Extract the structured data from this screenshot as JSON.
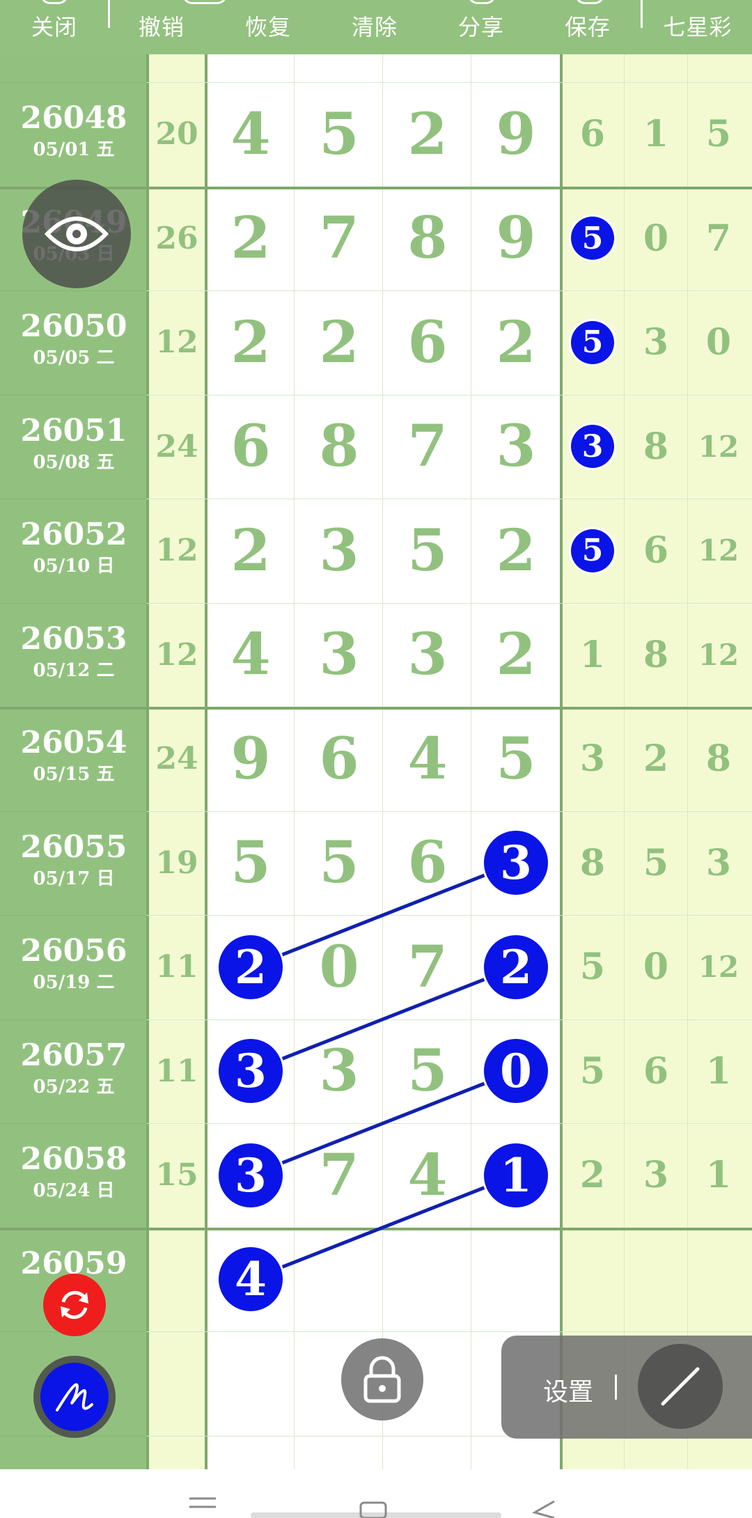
{
  "toolbar": {
    "items": [
      {
        "label": "关闭"
      },
      {
        "label": "撤销"
      },
      {
        "label": "恢复"
      },
      {
        "label": "清除"
      },
      {
        "label": "分享"
      },
      {
        "label": "保存"
      },
      {
        "label": "七星彩"
      }
    ]
  },
  "rows": [
    {
      "issue": "26048",
      "date": "05/01 五",
      "sum": "20",
      "digits": [
        "4",
        "5",
        "2",
        "9"
      ],
      "tail": [
        "6",
        "1",
        "5"
      ]
    },
    {
      "issue": "26049",
      "date": "05/03 日",
      "sum": "26",
      "digits": [
        "2",
        "7",
        "8",
        "9"
      ],
      "tail": [
        "5",
        "0",
        "7"
      ]
    },
    {
      "issue": "26050",
      "date": "05/05 二",
      "sum": "12",
      "digits": [
        "2",
        "2",
        "6",
        "2"
      ],
      "tail": [
        "5",
        "3",
        "0"
      ]
    },
    {
      "issue": "26051",
      "date": "05/08 五",
      "sum": "24",
      "digits": [
        "6",
        "8",
        "7",
        "3"
      ],
      "tail": [
        "3",
        "8",
        "12"
      ]
    },
    {
      "issue": "26052",
      "date": "05/10 日",
      "sum": "12",
      "digits": [
        "2",
        "3",
        "5",
        "2"
      ],
      "tail": [
        "5",
        "6",
        "12"
      ]
    },
    {
      "issue": "26053",
      "date": "05/12 二",
      "sum": "12",
      "digits": [
        "4",
        "3",
        "3",
        "2"
      ],
      "tail": [
        "1",
        "8",
        "12"
      ]
    },
    {
      "issue": "26054",
      "date": "05/15 五",
      "sum": "24",
      "digits": [
        "9",
        "6",
        "4",
        "5"
      ],
      "tail": [
        "3",
        "2",
        "8"
      ]
    },
    {
      "issue": "26055",
      "date": "05/17 日",
      "sum": "19",
      "digits": [
        "5",
        "5",
        "6",
        "3"
      ],
      "tail": [
        "8",
        "5",
        "3"
      ]
    },
    {
      "issue": "26056",
      "date": "05/19 二",
      "sum": "11",
      "digits": [
        "2",
        "0",
        "7",
        "2"
      ],
      "tail": [
        "5",
        "0",
        "12"
      ]
    },
    {
      "issue": "26057",
      "date": "05/22 五",
      "sum": "11",
      "digits": [
        "3",
        "3",
        "5",
        "0"
      ],
      "tail": [
        "5",
        "6",
        "1"
      ]
    },
    {
      "issue": "26058",
      "date": "05/24 日",
      "sum": "15",
      "digits": [
        "3",
        "7",
        "4",
        "1"
      ],
      "tail": [
        "2",
        "3",
        "1"
      ]
    },
    {
      "issue": "26059",
      "date": "",
      "sum": "",
      "digits": [
        "4",
        "",
        "",
        ""
      ],
      "tail": [
        "",
        "",
        ""
      ]
    },
    {
      "issue": "",
      "date": "",
      "sum": "",
      "digits": [
        "",
        "",
        "",
        ""
      ],
      "tail": [
        "",
        "",
        ""
      ]
    },
    {
      "issue": "",
      "date": "",
      "sum": "",
      "digits": [
        "",
        "",
        "",
        ""
      ],
      "tail": [
        "",
        "",
        ""
      ]
    }
  ],
  "marked_cells": [
    {
      "row": 1,
      "col": "tail",
      "index": 0
    },
    {
      "row": 2,
      "col": "tail",
      "index": 0
    },
    {
      "row": 3,
      "col": "tail",
      "index": 0
    },
    {
      "row": 4,
      "col": "tail",
      "index": 0
    },
    {
      "row": 7,
      "col": "digits",
      "index": 3
    },
    {
      "row": 8,
      "col": "digits",
      "index": 0
    },
    {
      "row": 8,
      "col": "digits",
      "index": 3
    },
    {
      "row": 9,
      "col": "digits",
      "index": 0
    },
    {
      "row": 9,
      "col": "digits",
      "index": 3
    },
    {
      "row": 10,
      "col": "digits",
      "index": 0
    },
    {
      "row": 10,
      "col": "digits",
      "index": 3
    },
    {
      "row": 11,
      "col": "digits",
      "index": 0
    }
  ],
  "drawn_lines": [
    {
      "from": {
        "row": 7,
        "index": 3
      },
      "to": {
        "row": 8,
        "index": 0
      }
    },
    {
      "from": {
        "row": 8,
        "index": 3
      },
      "to": {
        "row": 9,
        "index": 0
      }
    },
    {
      "from": {
        "row": 9,
        "index": 3
      },
      "to": {
        "row": 10,
        "index": 0
      }
    },
    {
      "from": {
        "row": 10,
        "index": 3
      },
      "to": {
        "row": 11,
        "index": 0
      }
    }
  ],
  "settings": {
    "label": "设置"
  },
  "colors": {
    "toolbar_bg": "#93c17f",
    "issue_col_bg": "#92c17f",
    "yellow_col_bg": "#f3fad2",
    "number_green": "#92c17f",
    "marker_blue": "#0a14e6",
    "line_blue": "#1020b0",
    "refresh_red": "#f01d1d"
  },
  "icons": [
    "eye-icon",
    "refresh-icon",
    "pen-icon",
    "lock-icon",
    "line-tool-icon",
    "menu-icon",
    "home-icon",
    "back-icon"
  ]
}
